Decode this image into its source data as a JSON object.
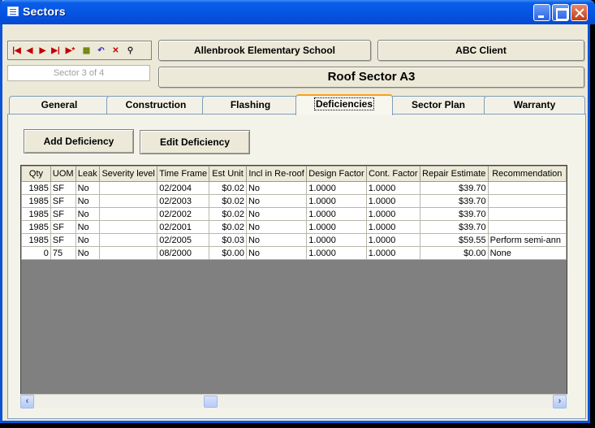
{
  "window": {
    "title": "Sectors"
  },
  "header": {
    "school": "Allenbrook Elementary School",
    "client": "ABC Client",
    "sector": "Roof Sector A3",
    "record_counter": "Sector 3 of 4"
  },
  "nav_icons": [
    "first-record-icon",
    "prev-record-icon",
    "next-record-icon",
    "last-record-icon",
    "new-record-icon",
    "save-icon",
    "undo-icon",
    "delete-icon",
    "find-icon"
  ],
  "tabs": [
    "General",
    "Construction",
    "Flashing",
    "Deficiencies",
    "Sector Plan",
    "Warranty"
  ],
  "active_tab": "Deficiencies",
  "buttons": {
    "add": "Add Deficiency",
    "edit": "Edit Deficiency"
  },
  "grid": {
    "columns": [
      "Qty",
      "UOM",
      "Leak",
      "Severity level",
      "Time Frame",
      "Est Unit",
      "Incl in Re-roof",
      "Design Factor",
      "Cont. Factor",
      "Repair Estimate",
      "Recommendation"
    ],
    "rows": [
      [
        "1985",
        "SF",
        "No",
        "",
        "02/2004",
        "$0.02",
        "No",
        "1.0000",
        "1.0000",
        "$39.70",
        ""
      ],
      [
        "1985",
        "SF",
        "No",
        "",
        "02/2003",
        "$0.02",
        "No",
        "1.0000",
        "1.0000",
        "$39.70",
        ""
      ],
      [
        "1985",
        "SF",
        "No",
        "",
        "02/2002",
        "$0.02",
        "No",
        "1.0000",
        "1.0000",
        "$39.70",
        ""
      ],
      [
        "1985",
        "SF",
        "No",
        "",
        "02/2001",
        "$0.02",
        "No",
        "1.0000",
        "1.0000",
        "$39.70",
        ""
      ],
      [
        "1985",
        "SF",
        "No",
        "",
        "02/2005",
        "$0.03",
        "No",
        "1.0000",
        "1.0000",
        "$59.55",
        "Perform semi-ann"
      ],
      [
        "0",
        "75",
        "No",
        "",
        "08/2000",
        "$0.00",
        "No",
        "1.0000",
        "1.0000",
        "$0.00",
        "None"
      ]
    ]
  }
}
